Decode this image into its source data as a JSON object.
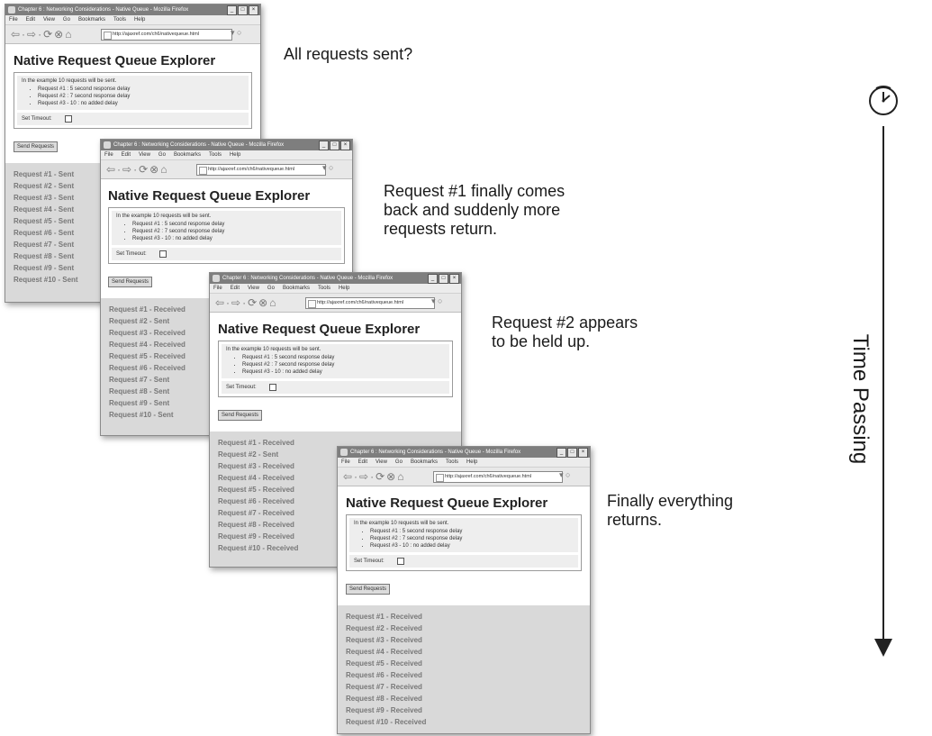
{
  "windows": [
    {
      "title": "Chapter 6 : Networking Considerations - Native Queue - Mozilla Firefox",
      "menu": [
        "File",
        "Edit",
        "View",
        "Go",
        "Bookmarks",
        "Tools",
        "Help"
      ],
      "url": "http://ajaxref.com/ch6/nativequeue.html",
      "page_title": "Native Request Queue Explorer",
      "intro": "In the example 10 requests will be sent.",
      "bullets": [
        "Request #1 : 5 second response delay",
        "Request #2 : 7 second response delay",
        "Request #3 - 10 : no added delay"
      ],
      "timeout_label": "Set Timeout:",
      "send_button": "Send Requests",
      "results": [
        "Request #1 - Sent",
        "Request #2 - Sent",
        "Request #3 - Sent",
        "Request #4 - Sent",
        "Request #5 - Sent",
        "Request #6 - Sent",
        "Request #7 - Sent",
        "Request #8 - Sent",
        "Request #9 - Sent",
        "Request #10 - Sent"
      ],
      "caption": "All requests sent?"
    },
    {
      "title": "Chapter 6 : Networking Considerations - Native Queue - Mozilla Firefox",
      "menu": [
        "File",
        "Edit",
        "View",
        "Go",
        "Bookmarks",
        "Tools",
        "Help"
      ],
      "url": "http://ajaxref.com/ch6/nativequeue.html",
      "page_title": "Native Request Queue Explorer",
      "intro": "In the example 10 requests will be sent.",
      "bullets": [
        "Request #1 : 5 second response delay",
        "Request #2 : 7 second response delay",
        "Request #3 - 10 : no added delay"
      ],
      "timeout_label": "Set Timeout:",
      "send_button": "Send Requests",
      "results": [
        "Request #1 - Received",
        "Request #2 - Sent",
        "Request #3 - Received",
        "Request #4 - Received",
        "Request #5 - Received",
        "Request #6 - Received",
        "Request #7 - Sent",
        "Request #8 - Sent",
        "Request #9 - Sent",
        "Request #10 - Sent"
      ],
      "caption": "Request #1 finally comes\nback and suddenly more\nrequests return."
    },
    {
      "title": "Chapter 6 : Networking Considerations - Native Queue - Mozilla Firefox",
      "menu": [
        "File",
        "Edit",
        "View",
        "Go",
        "Bookmarks",
        "Tools",
        "Help"
      ],
      "url": "http://ajaxref.com/ch6/nativequeue.html",
      "page_title": "Native Request Queue Explorer",
      "intro": "In the example 10 requests will be sent.",
      "bullets": [
        "Request #1 : 5 second response delay",
        "Request #2 : 7 second response delay",
        "Request #3 - 10 : no added delay"
      ],
      "timeout_label": "Set Timeout:",
      "send_button": "Send Requests",
      "results": [
        "Request #1 - Received",
        "Request #2 - Sent",
        "Request #3 - Received",
        "Request #4 - Received",
        "Request #5 - Received",
        "Request #6 - Received",
        "Request #7 - Received",
        "Request #8 - Received",
        "Request #9 - Received",
        "Request #10 - Received"
      ],
      "caption": "Request #2 appears\nto be held up."
    },
    {
      "title": "Chapter 6 : Networking Considerations - Native Queue - Mozilla Firefox",
      "menu": [
        "File",
        "Edit",
        "View",
        "Go",
        "Bookmarks",
        "Tools",
        "Help"
      ],
      "url": "http://ajaxref.com/ch6/nativequeue.html",
      "page_title": "Native Request Queue Explorer",
      "intro": "In the example 10 requests will be sent.",
      "bullets": [
        "Request #1 : 5 second response delay",
        "Request #2 : 7 second response delay",
        "Request #3 - 10 : no added delay"
      ],
      "timeout_label": "Set Timeout:",
      "send_button": "Send Requests",
      "results": [
        "Request #1 - Received",
        "Request #2 - Received",
        "Request #3 - Received",
        "Request #4 - Received",
        "Request #5 - Received",
        "Request #6 - Received",
        "Request #7 - Received",
        "Request #8 - Received",
        "Request #9 - Received",
        "Request #10 - Received"
      ],
      "caption": "Finally everything\nreturns."
    }
  ],
  "timeline": {
    "label": "Time Passing",
    "icon": "clock-icon"
  }
}
